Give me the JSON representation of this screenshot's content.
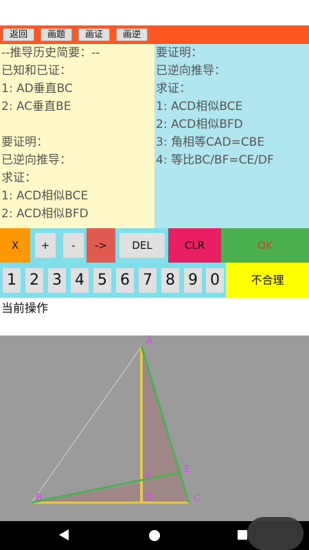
{
  "toolbar": {
    "back": "返回",
    "draw_problem": "画题",
    "draw_proof": "画证",
    "draw_reverse": "画逆"
  },
  "history": {
    "lines": [
      "--推导历史简要：--",
      "已知和已证：",
      "1: AD垂直BC",
      "2: AC垂直BE",
      "",
      "要证明：",
      "已逆向推导：",
      "求证：",
      "1: ACD相似BCE",
      "2: ACD相似BFD"
    ]
  },
  "goal": {
    "lines": [
      "要证明：",
      "已逆向推导：",
      "求证：",
      "1: ACD相似BCE",
      "2: ACD相似BFD",
      "3: 角相等CAD=CBE",
      "4: 等比BC/BF=CE/DF"
    ]
  },
  "ops": {
    "x": "X",
    "plus": "+",
    "minus": "-",
    "arrow": "->",
    "del": "DEL",
    "clr": "CLR",
    "ok": "OK"
  },
  "numbers": [
    "1",
    "2",
    "3",
    "4",
    "5",
    "6",
    "7",
    "8",
    "9",
    "0"
  ],
  "unreasonable": "不合理",
  "current_op": "当前操作",
  "figure": {
    "points": {
      "A": "A",
      "B": "B",
      "C": "C",
      "D": "D",
      "E": "E",
      "F": "F"
    }
  },
  "colors": {
    "toolbar": "#ff5722",
    "panel_left": "#fff8c8",
    "panel_right": "#b0e6ee",
    "op_row": "#80deea",
    "x_btn": "#ff9800",
    "arrow_btn": "#e05a4f",
    "clr_btn": "#e91e63",
    "ok_btn": "#4caf50",
    "ok_text": "#d83a2a",
    "unreasonable_btn": "#ffff00",
    "canvas": "#9b9b9b",
    "point_label": "#e040fb",
    "green_line": "#4caf50",
    "yellow_line": "#e6c84a"
  }
}
